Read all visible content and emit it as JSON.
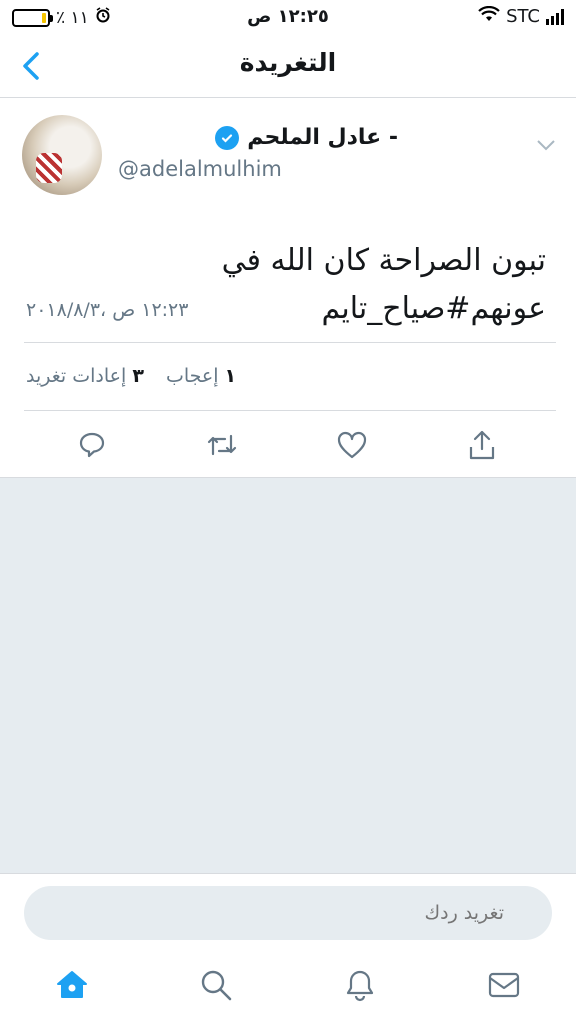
{
  "status_bar": {
    "battery_text": "٪ ١١",
    "battery_level": 0.11,
    "time": "١٢:٢٥ ص",
    "carrier": "STC"
  },
  "nav": {
    "title": "التغريدة",
    "back_icon": "chevron-left-icon"
  },
  "tweet": {
    "author_name": "عادل الملحم -",
    "handle": "@adelalmulhim",
    "text": "تبون الصراحة كان الله في عونهم#صياح_تايم",
    "date": "١٢:٢٣ ص ،٢٠١٨/٨/٣",
    "stats": {
      "likes_count": "١",
      "likes_label": "إعجاب",
      "retweets_count": "٣",
      "retweets_label": "إعادات تغريد"
    }
  },
  "reply": {
    "placeholder": "تغريد ردك"
  },
  "colors": {
    "accent": "#1da1f2",
    "muted": "#657786",
    "background": "#e6ecf0"
  }
}
